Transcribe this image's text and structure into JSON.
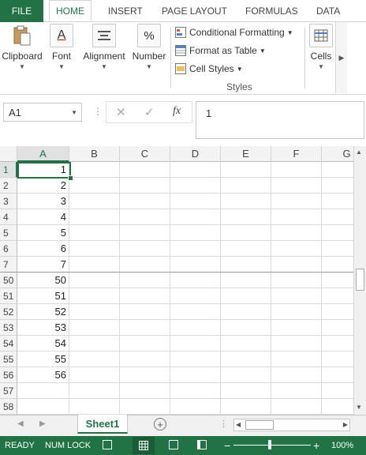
{
  "ribbon_tabs": [
    "FILE",
    "HOME",
    "INSERT",
    "PAGE LAYOUT",
    "FORMULAS",
    "DATA"
  ],
  "ribbon": {
    "clipboard": "Clipboard",
    "font": "Font",
    "alignment": "Alignment",
    "number": "Number",
    "cond_format": "Conditional Formatting",
    "format_table": "Format as Table",
    "cell_styles": "Cell Styles",
    "styles_group": "Styles",
    "cells": "Cells",
    "number_icon_glyph": "%",
    "font_icon_glyph": "A"
  },
  "formula_bar": {
    "name_box": "A1",
    "cancel": "✕",
    "enter": "✓",
    "fx": "fx",
    "content": "1"
  },
  "columns": [
    "A",
    "B",
    "C",
    "D",
    "E",
    "F",
    "G"
  ],
  "rows": [
    {
      "label": "1",
      "a": "1"
    },
    {
      "label": "2",
      "a": "2"
    },
    {
      "label": "3",
      "a": "3"
    },
    {
      "label": "4",
      "a": "4"
    },
    {
      "label": "5",
      "a": "5"
    },
    {
      "label": "6",
      "a": "6"
    },
    {
      "label": "7",
      "a": "7"
    },
    {
      "label": "50",
      "a": "50"
    },
    {
      "label": "51",
      "a": "51"
    },
    {
      "label": "52",
      "a": "52"
    },
    {
      "label": "53",
      "a": "53"
    },
    {
      "label": "54",
      "a": "54"
    },
    {
      "label": "55",
      "a": "55"
    },
    {
      "label": "56",
      "a": "56"
    },
    {
      "label": "57",
      "a": ""
    },
    {
      "label": "58",
      "a": ""
    }
  ],
  "sheet_tabs": [
    "Sheet1"
  ],
  "status": {
    "ready": "READY",
    "num_lock": "NUM LOCK",
    "zoom_minus": "−",
    "zoom_plus": "+",
    "zoom": "100%"
  },
  "colors": {
    "accent": "#217346",
    "gridline": "#d9d9d9"
  }
}
